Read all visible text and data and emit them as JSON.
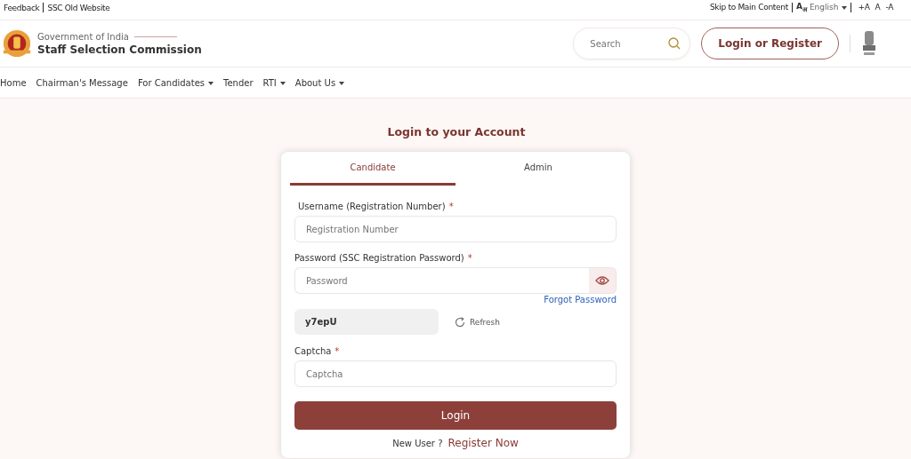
{
  "top_bar": {
    "left_links": [
      "Feedback",
      "SSC Old Website"
    ],
    "skip_link": "Skip to Main Content",
    "language_icon": "A$_{अ}$",
    "language": "English",
    "font_sizes": [
      "+A",
      "A",
      "-A"
    ]
  },
  "header": {
    "org_line": "Government of India",
    "org_name": "Staff Selection Commission",
    "search": {
      "placeholder": "Search"
    },
    "login_button": "Login or Register"
  },
  "nav": [
    {
      "label": "Home",
      "has_menu": false
    },
    {
      "label": "Chairman's Message",
      "has_menu": false
    },
    {
      "label": "For Candidates",
      "has_menu": true
    },
    {
      "label": "Tender",
      "has_menu": false
    },
    {
      "label": "RTI",
      "has_menu": true
    },
    {
      "label": "About Us",
      "has_menu": true
    }
  ],
  "login": {
    "title": "Login to your Account",
    "tabs": [
      {
        "label": "Candidate",
        "selected": true
      },
      {
        "label": "Admin",
        "selected": false
      }
    ],
    "username": {
      "label": "Username (Registration Number)",
      "required_mark": "*",
      "placeholder": "Registration Number"
    },
    "password": {
      "label": "Password (SSC Registration Password)",
      "required_mark": "*",
      "placeholder": "Password"
    },
    "forgot_link": "Forgot Password",
    "captcha_code": "y7epU",
    "refresh": "Refresh",
    "captcha": {
      "label": "Captcha",
      "required_mark": "*",
      "placeholder": "Captcha"
    },
    "submit": "Login",
    "new_user": "New User ?",
    "register_link": "Register Now"
  }
}
